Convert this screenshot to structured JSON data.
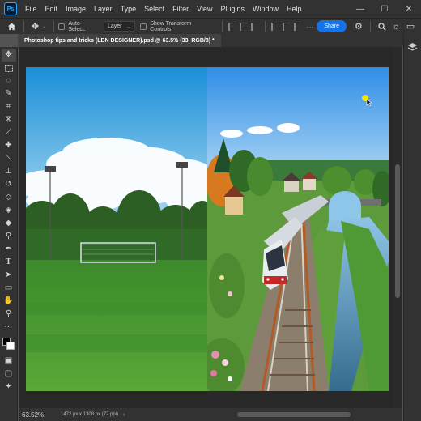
{
  "app": {
    "logo_text": "Ps",
    "menu": [
      "File",
      "Edit",
      "Image",
      "Layer",
      "Type",
      "Select",
      "Filter",
      "View",
      "Plugins",
      "Window",
      "Help"
    ]
  },
  "window_controls": {
    "minimize": "—",
    "maximize": "☐",
    "close": "✕"
  },
  "options_bar": {
    "auto_select_label": "Auto-Select:",
    "layer_select_value": "Layer",
    "show_transform_label": "Show Transform Controls",
    "share_label": "Share",
    "icons": [
      "home-icon",
      "move-tool-icon",
      "align-icons",
      "gear-icon",
      "search-icon",
      "lightbulb-icon",
      "workspace-icon"
    ]
  },
  "document": {
    "tab_title": "Photoshop tips and tricks (LBN DESIGNER).psd @ 63.5% (33, RGB/8) *"
  },
  "status_bar": {
    "zoom": "63.52%",
    "doc_info": "1472 px x 1308 px (72 ppi)",
    "arrow": "›"
  },
  "colors": {
    "accent": "#1473e6",
    "chrome": "#323232",
    "canvas_bg": "#282828",
    "foreground": "#000000",
    "background": "#ffffff"
  },
  "tools": [
    "move-tool-icon",
    "marquee-tool-icon",
    "lasso-tool-icon",
    "quick-select-tool-icon",
    "crop-tool-icon",
    "frame-tool-icon",
    "eyedropper-tool-icon",
    "healing-brush-icon",
    "brush-tool-icon",
    "clone-stamp-icon",
    "history-brush-icon",
    "eraser-tool-icon",
    "paint-bucket-icon",
    "blur-tool-icon",
    "dodge-tool-icon",
    "pen-tool-icon",
    "type-tool-icon",
    "path-select-icon",
    "shape-tool-icon",
    "hand-tool-icon",
    "zoom-tool-icon",
    "more-tools-icon"
  ]
}
